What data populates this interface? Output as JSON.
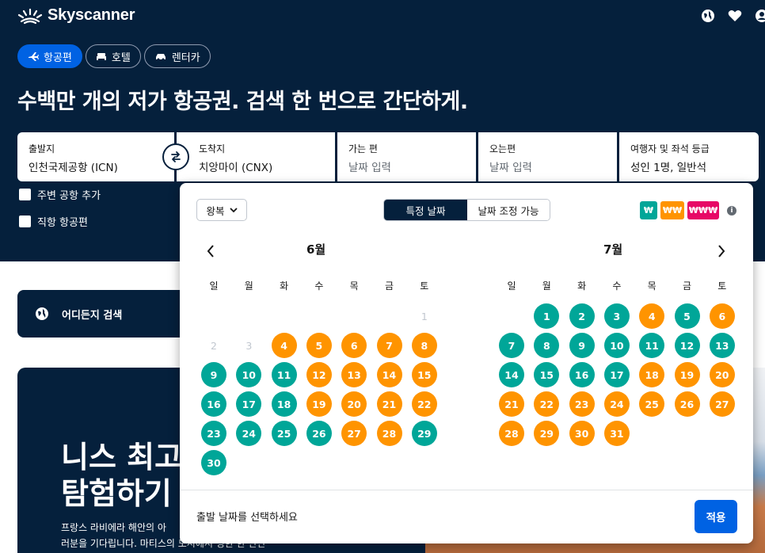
{
  "brand": {
    "name": "Skyscanner"
  },
  "tabs": [
    {
      "label": "항공편",
      "icon": "plane-icon",
      "active": true
    },
    {
      "label": "호텔",
      "icon": "bed-icon",
      "active": false
    },
    {
      "label": "렌터카",
      "icon": "car-icon",
      "active": false
    }
  ],
  "headline": "수백만 개의 저가 항공권. 검색 한 번으로 간단하게.",
  "search": {
    "origin": {
      "label": "출발지",
      "value": "인천국제공항 (ICN)"
    },
    "destination": {
      "label": "도착지",
      "value": "치앙마이 (CNX)"
    },
    "depart": {
      "label": "가는 편",
      "placeholder": "날짜 입력"
    },
    "return": {
      "label": "오는편",
      "placeholder": "날짜 입력"
    },
    "travellers": {
      "label": "여행자 및 좌석 등급",
      "value": "성인 1명, 일반석"
    }
  },
  "options": {
    "nearby": "주변 공항 추가",
    "direct": "직항 항공편"
  },
  "anywhere": "어디든지 검색",
  "promo": {
    "title_line1": "니스 최고",
    "title_line2": "탐험하기",
    "text_line1": "프랑스 라비에라 해안의 아",
    "text_line2": "러분을 기다립니다. 마티스의 도시에서 명한 한 만난"
  },
  "calendar": {
    "trip_type": "왕복",
    "mode_specific": "특정 날짜",
    "mode_flexible": "날짜 조정 가능",
    "legend": {
      "low": "₩",
      "mid": "₩₩",
      "high": "₩₩₩"
    },
    "weekdays": [
      "일",
      "월",
      "화",
      "수",
      "목",
      "금",
      "토"
    ],
    "months": [
      {
        "name": "6월",
        "days": [
          {
            "day": 1,
            "col": 6,
            "row": 0,
            "p": "past"
          },
          {
            "day": 2,
            "col": 0,
            "row": 1,
            "p": "past"
          },
          {
            "day": 3,
            "col": 1,
            "row": 1,
            "p": "past"
          },
          {
            "day": 4,
            "col": 2,
            "row": 1,
            "p": "mid"
          },
          {
            "day": 5,
            "col": 3,
            "row": 1,
            "p": "mid"
          },
          {
            "day": 6,
            "col": 4,
            "row": 1,
            "p": "mid"
          },
          {
            "day": 7,
            "col": 5,
            "row": 1,
            "p": "mid"
          },
          {
            "day": 8,
            "col": 6,
            "row": 1,
            "p": "mid"
          },
          {
            "day": 9,
            "col": 0,
            "row": 2,
            "p": "low"
          },
          {
            "day": 10,
            "col": 1,
            "row": 2,
            "p": "low"
          },
          {
            "day": 11,
            "col": 2,
            "row": 2,
            "p": "low"
          },
          {
            "day": 12,
            "col": 3,
            "row": 2,
            "p": "mid"
          },
          {
            "day": 13,
            "col": 4,
            "row": 2,
            "p": "mid"
          },
          {
            "day": 14,
            "col": 5,
            "row": 2,
            "p": "mid"
          },
          {
            "day": 15,
            "col": 6,
            "row": 2,
            "p": "mid"
          },
          {
            "day": 16,
            "col": 0,
            "row": 3,
            "p": "low"
          },
          {
            "day": 17,
            "col": 1,
            "row": 3,
            "p": "low"
          },
          {
            "day": 18,
            "col": 2,
            "row": 3,
            "p": "low"
          },
          {
            "day": 19,
            "col": 3,
            "row": 3,
            "p": "mid"
          },
          {
            "day": 20,
            "col": 4,
            "row": 3,
            "p": "mid"
          },
          {
            "day": 21,
            "col": 5,
            "row": 3,
            "p": "mid"
          },
          {
            "day": 22,
            "col": 6,
            "row": 3,
            "p": "mid"
          },
          {
            "day": 23,
            "col": 0,
            "row": 4,
            "p": "low"
          },
          {
            "day": 24,
            "col": 1,
            "row": 4,
            "p": "low"
          },
          {
            "day": 25,
            "col": 2,
            "row": 4,
            "p": "low"
          },
          {
            "day": 26,
            "col": 3,
            "row": 4,
            "p": "low"
          },
          {
            "day": 27,
            "col": 4,
            "row": 4,
            "p": "mid"
          },
          {
            "day": 28,
            "col": 5,
            "row": 4,
            "p": "mid"
          },
          {
            "day": 29,
            "col": 6,
            "row": 4,
            "p": "low"
          },
          {
            "day": 30,
            "col": 0,
            "row": 5,
            "p": "low"
          }
        ]
      },
      {
        "name": "7월",
        "days": [
          {
            "day": 1,
            "col": 1,
            "row": 0,
            "p": "low"
          },
          {
            "day": 2,
            "col": 2,
            "row": 0,
            "p": "low"
          },
          {
            "day": 3,
            "col": 3,
            "row": 0,
            "p": "low"
          },
          {
            "day": 4,
            "col": 4,
            "row": 0,
            "p": "mid"
          },
          {
            "day": 5,
            "col": 5,
            "row": 0,
            "p": "low"
          },
          {
            "day": 6,
            "col": 6,
            "row": 0,
            "p": "mid"
          },
          {
            "day": 7,
            "col": 0,
            "row": 1,
            "p": "low"
          },
          {
            "day": 8,
            "col": 1,
            "row": 1,
            "p": "low"
          },
          {
            "day": 9,
            "col": 2,
            "row": 1,
            "p": "low"
          },
          {
            "day": 10,
            "col": 3,
            "row": 1,
            "p": "low"
          },
          {
            "day": 11,
            "col": 4,
            "row": 1,
            "p": "low"
          },
          {
            "day": 12,
            "col": 5,
            "row": 1,
            "p": "low"
          },
          {
            "day": 13,
            "col": 6,
            "row": 1,
            "p": "low"
          },
          {
            "day": 14,
            "col": 0,
            "row": 2,
            "p": "low"
          },
          {
            "day": 15,
            "col": 1,
            "row": 2,
            "p": "low"
          },
          {
            "day": 16,
            "col": 2,
            "row": 2,
            "p": "low"
          },
          {
            "day": 17,
            "col": 3,
            "row": 2,
            "p": "low"
          },
          {
            "day": 18,
            "col": 4,
            "row": 2,
            "p": "mid"
          },
          {
            "day": 19,
            "col": 5,
            "row": 2,
            "p": "mid"
          },
          {
            "day": 20,
            "col": 6,
            "row": 2,
            "p": "mid"
          },
          {
            "day": 21,
            "col": 0,
            "row": 3,
            "p": "mid"
          },
          {
            "day": 22,
            "col": 1,
            "row": 3,
            "p": "mid"
          },
          {
            "day": 23,
            "col": 2,
            "row": 3,
            "p": "mid"
          },
          {
            "day": 24,
            "col": 3,
            "row": 3,
            "p": "mid"
          },
          {
            "day": 25,
            "col": 4,
            "row": 3,
            "p": "mid"
          },
          {
            "day": 26,
            "col": 5,
            "row": 3,
            "p": "mid"
          },
          {
            "day": 27,
            "col": 6,
            "row": 3,
            "p": "mid"
          },
          {
            "day": 28,
            "col": 0,
            "row": 4,
            "p": "mid"
          },
          {
            "day": 29,
            "col": 1,
            "row": 4,
            "p": "mid"
          },
          {
            "day": 30,
            "col": 2,
            "row": 4,
            "p": "mid"
          },
          {
            "day": 31,
            "col": 3,
            "row": 4,
            "p": "mid"
          }
        ]
      }
    ],
    "footer_text": "출발 날짜를 선택하세요",
    "apply_label": "적용"
  },
  "colors": {
    "navy": "#05203c",
    "brand_blue": "#0062e3",
    "price_low": "#00a698",
    "price_mid": "#ff9400",
    "price_high": "#e70866"
  }
}
